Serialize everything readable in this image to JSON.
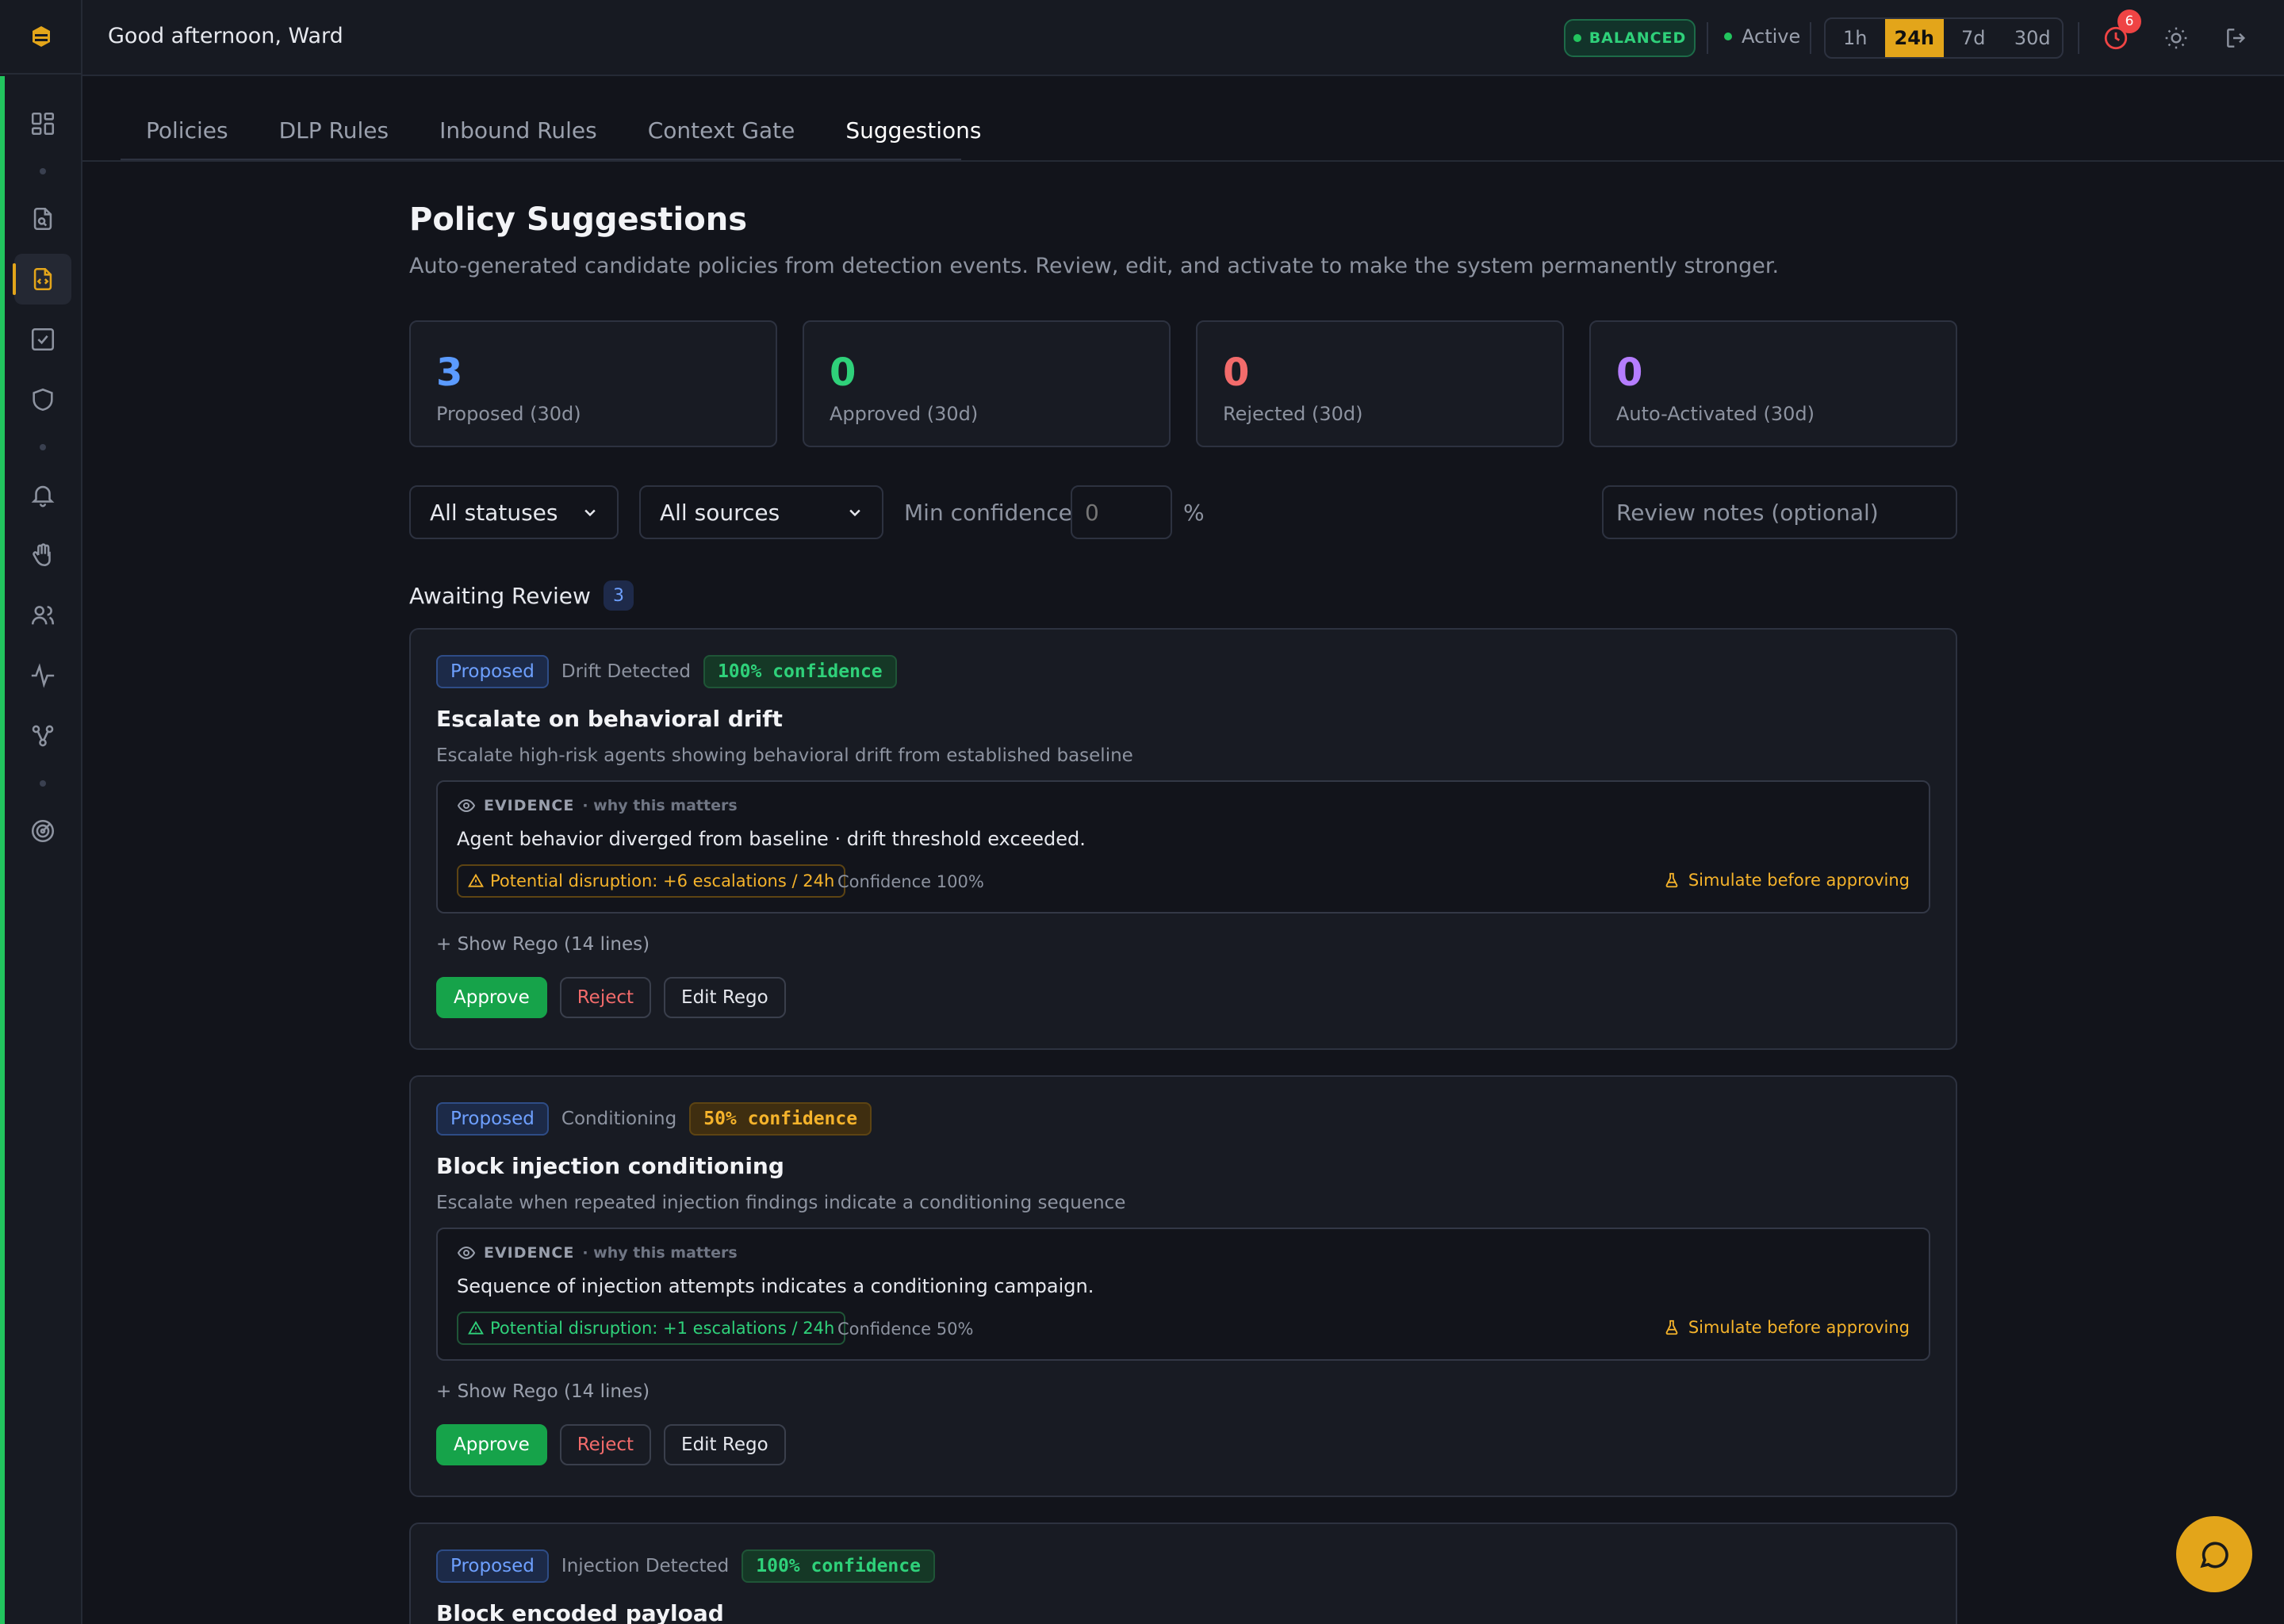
{
  "header": {
    "greeting": "Good afternoon, Ward",
    "mode_badge": "BALANCED",
    "status": "Active",
    "time_ranges": [
      "1h",
      "24h",
      "7d",
      "30d"
    ],
    "active_range": "24h",
    "notification_count": "6"
  },
  "sidebar": {
    "icons": [
      "dashboard-icon",
      "file-scan-icon",
      "policy-code-icon",
      "checklist-icon",
      "shield-icon",
      "bell-icon",
      "hand-icon",
      "users-icon",
      "activity-icon",
      "workflow-icon",
      "radar-icon"
    ],
    "active": "policy-code-icon"
  },
  "tabs": [
    {
      "label": "Policies"
    },
    {
      "label": "DLP Rules"
    },
    {
      "label": "Inbound Rules"
    },
    {
      "label": "Context Gate"
    },
    {
      "label": "Suggestions"
    }
  ],
  "active_tab": "Suggestions",
  "page": {
    "title": "Policy Suggestions",
    "subtitle": "Auto-generated candidate policies from detection events. Review, edit, and activate to make the system permanently stronger."
  },
  "stats": [
    {
      "value": "3",
      "label": "Proposed (30d)",
      "color": "#5b9bff"
    },
    {
      "value": "0",
      "label": "Approved (30d)",
      "color": "#2fd17a"
    },
    {
      "value": "0",
      "label": "Rejected (30d)",
      "color": "#f26b6b"
    },
    {
      "value": "0",
      "label": "Auto-Activated (30d)",
      "color": "#b57dff"
    }
  ],
  "filters": {
    "status_selected": "All statuses",
    "source_selected": "All sources",
    "min_conf_label": "Min confidence:",
    "min_conf_placeholder": "0",
    "pct": "%",
    "notes_placeholder": "Review notes (optional)"
  },
  "section": {
    "title": "Awaiting Review",
    "count": "3"
  },
  "evidence_label": "EVIDENCE",
  "evidence_why": "· why this matters",
  "simulate_label": "Simulate before approving",
  "buttons": {
    "approve": "Approve",
    "reject": "Reject",
    "edit": "Edit Rego"
  },
  "suggestions": [
    {
      "status": "Proposed",
      "source": "Drift Detected",
      "confidence": "100% confidence",
      "title": "Escalate on behavioral drift",
      "description": "Escalate high-risk agents showing behavioral drift from established baseline",
      "evidence": "Agent behavior diverged from baseline · drift threshold exceeded.",
      "disruption": "Potential disruption: +6 escalations / 24h",
      "confidence_text": "Confidence 100%",
      "show_rego": "+ Show Rego (14 lines)"
    },
    {
      "status": "Proposed",
      "source": "Conditioning",
      "confidence": "50% confidence",
      "title": "Block injection conditioning",
      "description": "Escalate when repeated injection findings indicate a conditioning sequence",
      "evidence": "Sequence of injection attempts indicates a conditioning campaign.",
      "disruption": "Potential disruption: +1 escalations / 24h",
      "confidence_text": "Confidence 50%",
      "show_rego": "+ Show Rego (14 lines)"
    },
    {
      "status": "Proposed",
      "source": "Injection Detected",
      "confidence": "100% confidence",
      "title": "Block encoded payload"
    }
  ]
}
